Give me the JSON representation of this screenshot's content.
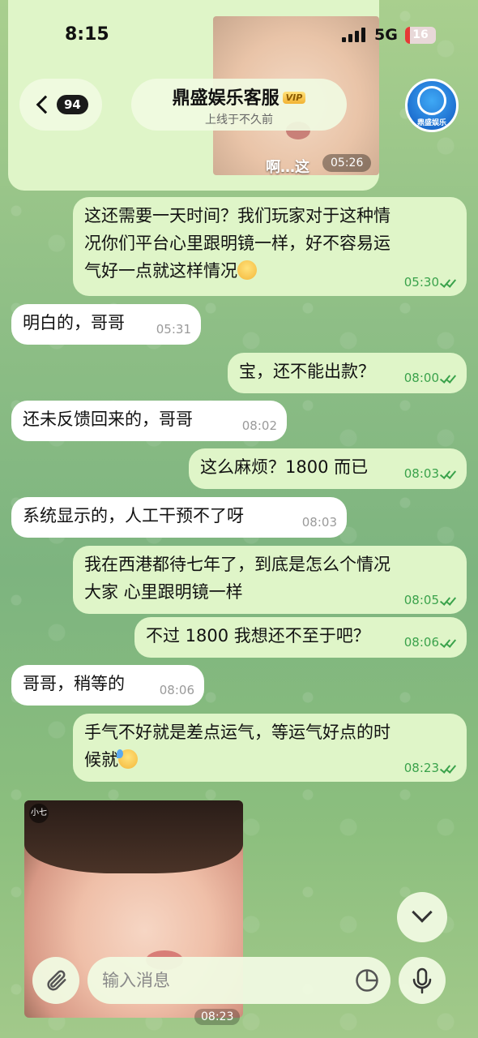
{
  "status": {
    "time": "8:15",
    "network": "5G",
    "battery": "16",
    "battery_level": 0.16
  },
  "header": {
    "back_count": "94",
    "title": "鼎盛娱乐客服",
    "vip": "VIP",
    "subtitle": "上线于不久前",
    "avatar_label": "鼎盛娱乐"
  },
  "previous_media": {
    "caption": "啊…这",
    "time": "05:26"
  },
  "messages": [
    {
      "dir": "out",
      "lines": [
        "这还需要一天时间？我们玩家对于这种情",
        "况你们平台心里跟明镜一样，好不容易运",
        "气好一点就这样情况"
      ],
      "time": "05:30"
    },
    {
      "dir": "in",
      "text": "明白的，哥哥",
      "time": "05:31"
    },
    {
      "dir": "out",
      "text": "宝，还不能出款？",
      "time": "08:00"
    },
    {
      "dir": "in",
      "text": "还未反馈回来的，哥哥",
      "time": "08:02"
    },
    {
      "dir": "out",
      "text": "这么麻烦？1800 而已",
      "time": "08:03"
    },
    {
      "dir": "in",
      "text": "系统显示的，人工干预不了呀",
      "time": "08:03"
    },
    {
      "dir": "out",
      "lines": [
        "我在西港都待七年了，到底是怎么个情况",
        "大家 心里跟明镜一样"
      ],
      "time": "08:05"
    },
    {
      "dir": "out",
      "text": "不过 1800 我想还不至于吧？",
      "time": "08:06"
    },
    {
      "dir": "in",
      "text": "哥哥，稍等的",
      "time": "08:06"
    },
    {
      "dir": "out",
      "lines": [
        "手气不好就是差点运气，等运气好点的时",
        "候就"
      ],
      "time": "08:23"
    }
  ],
  "sticker": {
    "tag": "小七",
    "time": "08:23"
  },
  "composer": {
    "placeholder": "输入消息"
  }
}
